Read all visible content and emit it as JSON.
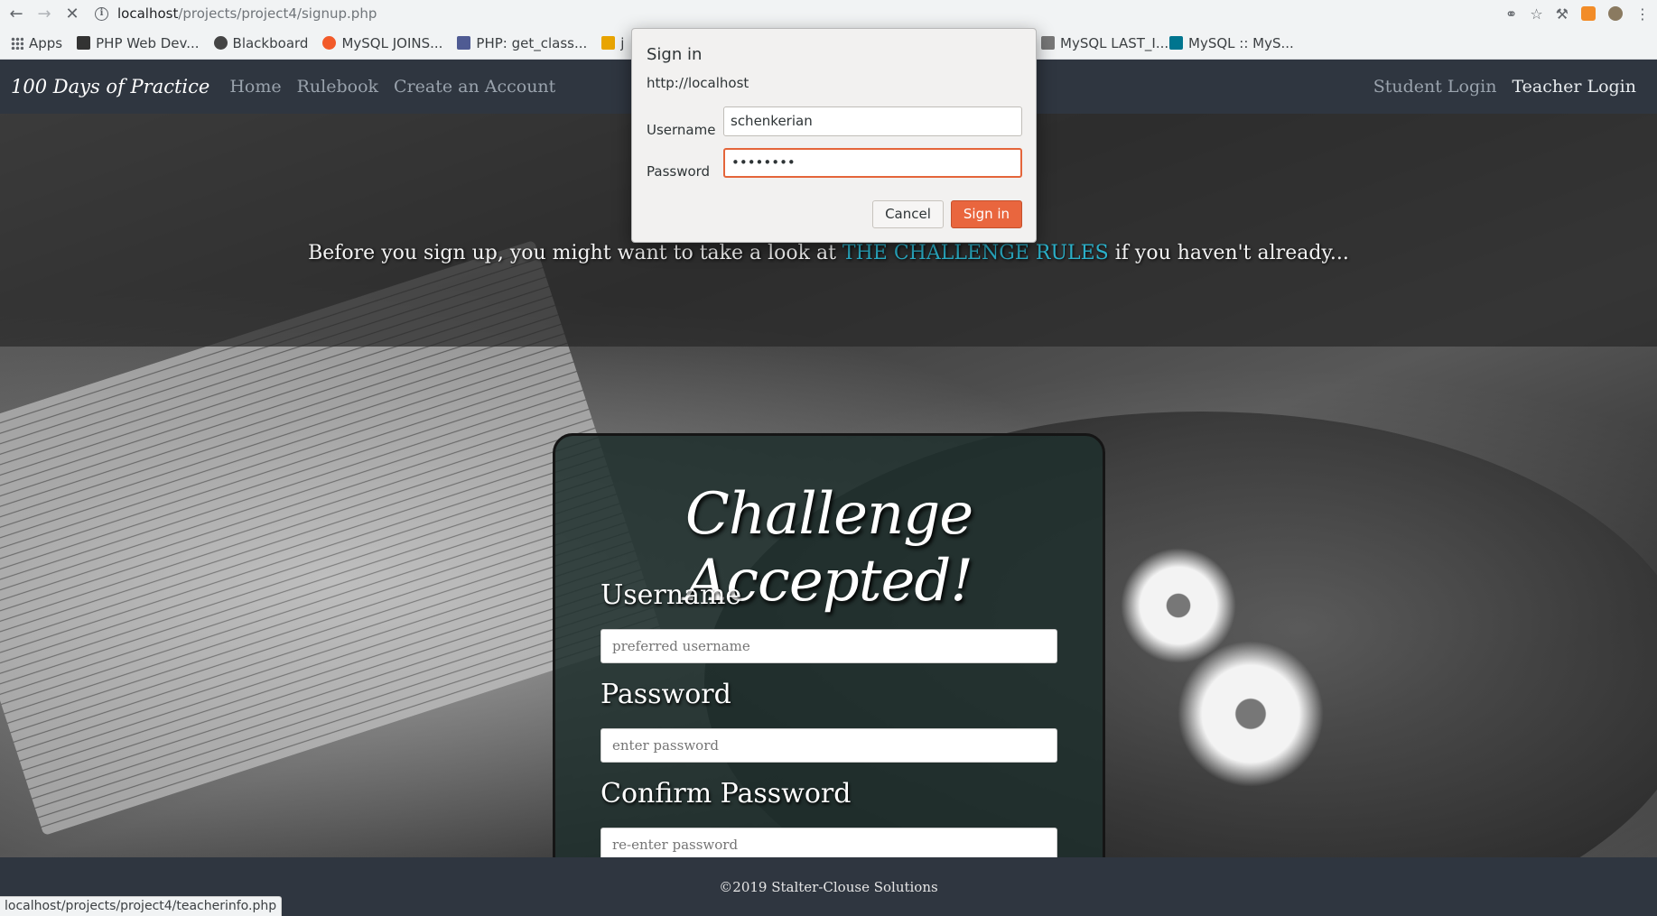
{
  "browser": {
    "url_host": "localhost",
    "url_path": "/projects/project4/signup.php",
    "bookmarks": [
      {
        "label": "Apps",
        "color": "#5f6368"
      },
      {
        "label": "PHP Web Dev...",
        "color": "#333333"
      },
      {
        "label": "Blackboard",
        "color": "#444444"
      },
      {
        "label": "MySQL JOINS...",
        "color": "#f25a29"
      },
      {
        "label": "PHP: get_class...",
        "color": "#4f5b93"
      },
      {
        "label": "j",
        "color": "#e8a400"
      },
      {
        "label": "MySQL LAST_I...",
        "color": "#777777"
      },
      {
        "label": "MySQL :: MyS...",
        "color": "#00758f"
      }
    ],
    "status_url": "localhost/projects/project4/teacherinfo.php"
  },
  "site_nav": {
    "brand": "100 Days of Practice",
    "links": [
      "Home",
      "Rulebook",
      "Create an Account"
    ],
    "right_links": [
      "Student Login",
      "Teacher Login"
    ]
  },
  "hero": {
    "text_before": "Before you sign up, you might want to take a look at ",
    "rules_link": "THE CHALLENGE RULES",
    "text_after": " if you haven't already..."
  },
  "signup_card": {
    "title": "Challenge Accepted!",
    "username_label": "Username",
    "username_placeholder": "preferred username",
    "password_label": "Password",
    "password_placeholder": "enter password",
    "confirm_label": "Confirm Password",
    "confirm_placeholder": "re-enter password"
  },
  "footer": {
    "text": "©2019 Stalter-Clouse Solutions"
  },
  "dialog": {
    "title": "Sign in",
    "origin": "http://localhost",
    "username_label": "Username",
    "username_value": "schenkerian",
    "password_label": "Password",
    "password_value": "••••••••",
    "cancel_label": "Cancel",
    "signin_label": "Sign in"
  },
  "colors": {
    "accent_orange": "#e9663e",
    "link_teal": "#2bb0c9",
    "navbar": "#2f3640"
  }
}
